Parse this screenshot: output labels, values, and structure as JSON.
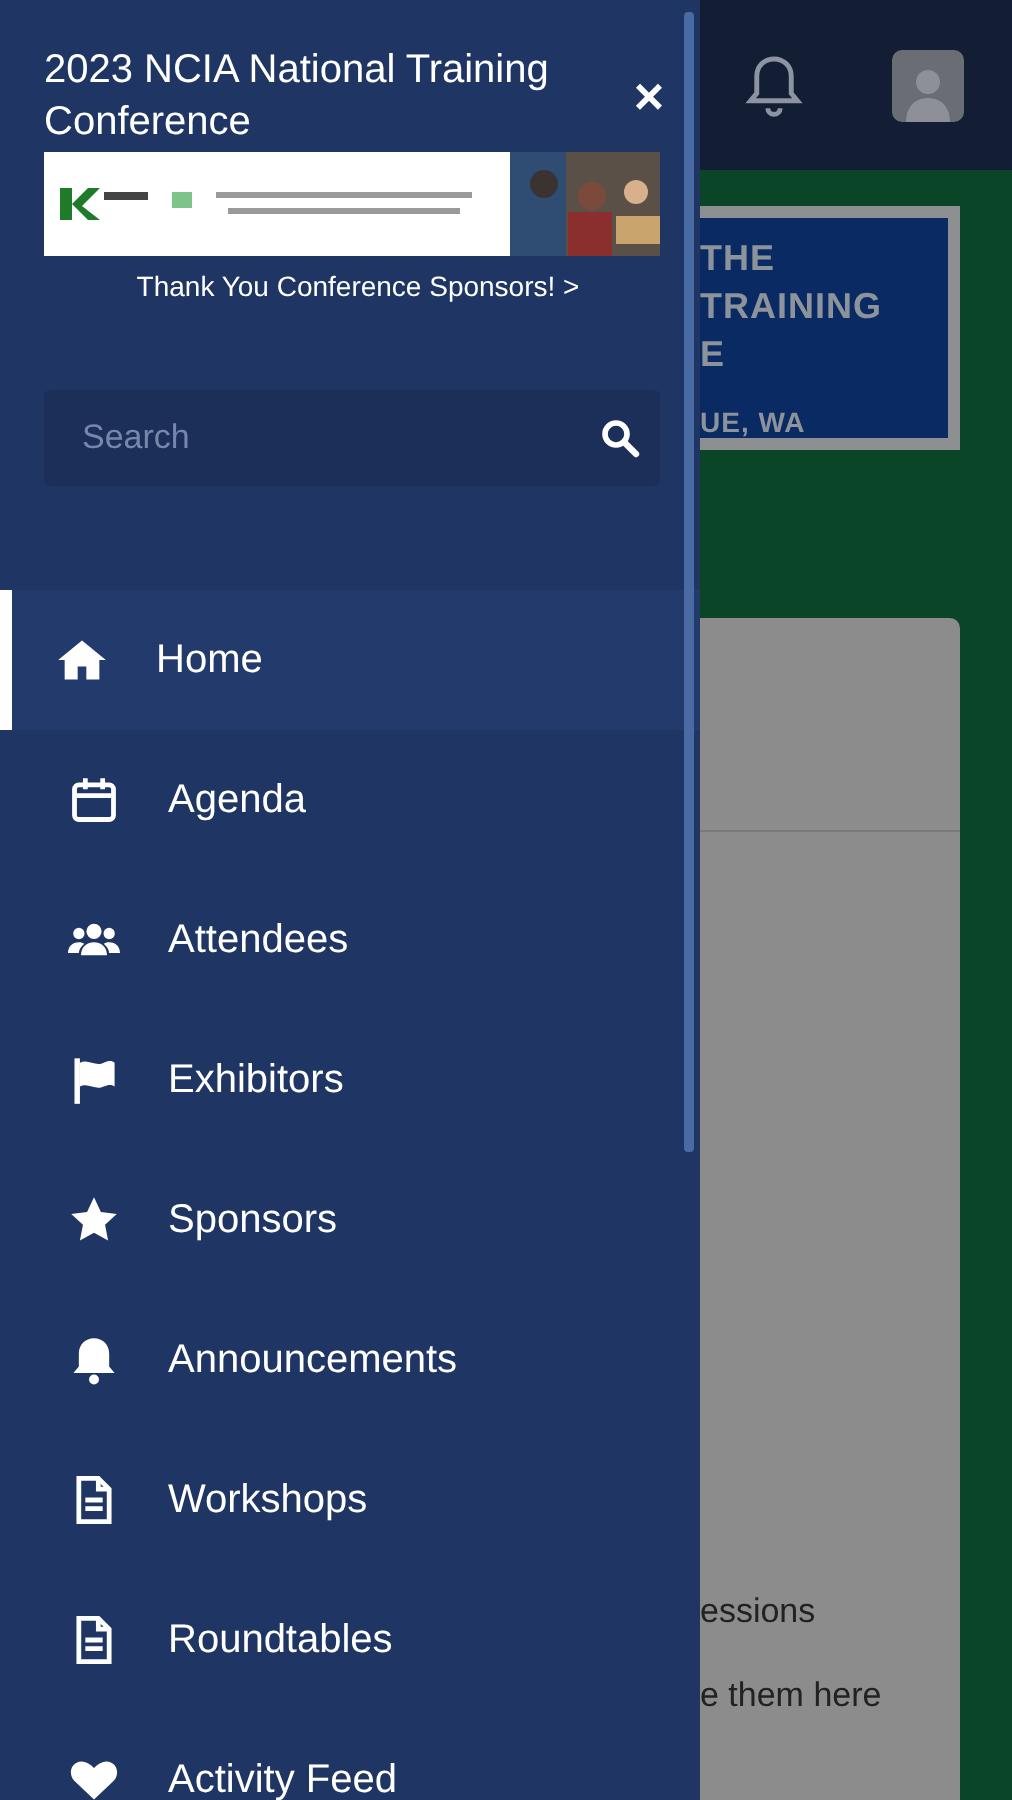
{
  "background_page": {
    "banner_lines": [
      "THE",
      "TRAINING",
      "E",
      "UE, WA"
    ],
    "card_texts": [
      "essions",
      "e them here"
    ]
  },
  "drawer": {
    "title": "2023 NCIA National Training Conference",
    "close": "×",
    "sponsors_link": "Thank You Conference Sponsors! >",
    "search": {
      "placeholder": "Search"
    },
    "items": [
      {
        "label": "Home",
        "selected": true
      },
      {
        "label": "Agenda",
        "selected": false
      },
      {
        "label": "Attendees",
        "selected": false
      },
      {
        "label": "Exhibitors",
        "selected": false
      },
      {
        "label": "Sponsors",
        "selected": false
      },
      {
        "label": "Announcements",
        "selected": false
      },
      {
        "label": "Workshops",
        "selected": false
      },
      {
        "label": "Roundtables",
        "selected": false
      },
      {
        "label": "Activity Feed",
        "selected": false
      }
    ]
  }
}
